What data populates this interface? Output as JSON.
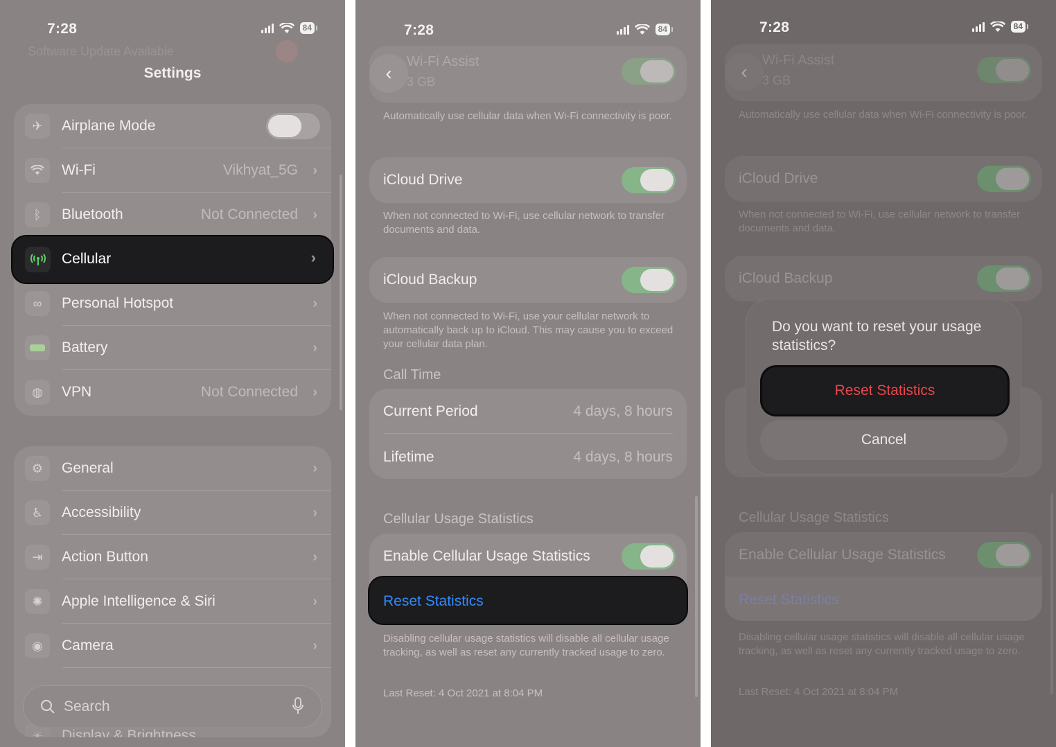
{
  "status": {
    "time": "7:28",
    "battery": "84"
  },
  "panel1": {
    "title": "Settings",
    "group1": [
      {
        "label": "Airplane Mode",
        "value": "",
        "icon": "airplane-icon"
      },
      {
        "label": "Wi-Fi",
        "value": "Vikhyat_5G",
        "icon": "wifi-icon"
      },
      {
        "label": "Bluetooth",
        "value": "Not Connected",
        "icon": "bluetooth-icon"
      },
      {
        "label": "Cellular",
        "value": "",
        "icon": "cellular-icon"
      },
      {
        "label": "Personal Hotspot",
        "value": "",
        "icon": "hotspot-icon"
      },
      {
        "label": "Battery",
        "value": "",
        "icon": "battery-icon"
      },
      {
        "label": "VPN",
        "value": "Not Connected",
        "icon": "vpn-icon"
      }
    ],
    "group2": [
      {
        "label": "General",
        "icon": "gear-icon"
      },
      {
        "label": "Accessibility",
        "icon": "accessibility-icon"
      },
      {
        "label": "Action Button",
        "icon": "action-button-icon"
      },
      {
        "label": "Apple Intelligence & Siri",
        "icon": "siri-icon"
      },
      {
        "label": "Camera",
        "icon": "camera-icon"
      },
      {
        "label": "Display & Brightness",
        "icon": "brightness-icon"
      }
    ],
    "search_placeholder": "Search"
  },
  "panel2": {
    "wifi_assist_label": "Wi-Fi Assist",
    "wifi_assist_size": "3 GB",
    "wifi_assist_desc": "Automatically use cellular data when Wi-Fi connectivity is poor.",
    "icloud_drive_label": "iCloud Drive",
    "icloud_drive_desc": "When not connected to Wi-Fi, use cellular network to transfer documents and data.",
    "icloud_backup_label": "iCloud Backup",
    "icloud_backup_desc": "When not connected to Wi-Fi, use your cellular network to automatically back up to iCloud. This may cause you to exceed your cellular data plan.",
    "call_time_header": "Call Time",
    "current_period_label": "Current Period",
    "current_period_value": "4 days, 8 hours",
    "lifetime_label": "Lifetime",
    "lifetime_value": "4 days, 8 hours",
    "usage_header": "Cellular Usage Statistics",
    "enable_usage_label": "Enable Cellular Usage Statistics",
    "reset_label": "Reset Statistics",
    "usage_desc": "Disabling cellular usage statistics will disable all cellular usage tracking, as well as reset any currently tracked usage to zero.",
    "last_reset": "Last Reset: 4 Oct 2021 at 8:04 PM"
  },
  "dialog": {
    "message": "Do you want to reset your usage statistics?",
    "confirm_label": "Reset Statistics",
    "cancel_label": "Cancel"
  },
  "colors": {
    "accent_blue": "#2f8cff",
    "destructive_red": "#e8474c",
    "toggle_green": "#86b58a"
  }
}
